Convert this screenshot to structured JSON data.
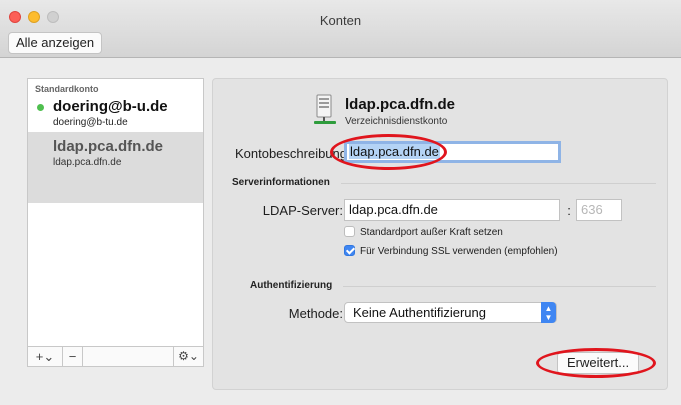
{
  "window": {
    "title": "Konten",
    "show_all_label": "Alle anzeigen"
  },
  "sidebar": {
    "header": "Standardkonto",
    "accounts": [
      {
        "name": "doering@b-u.de",
        "sub": "doering@b-tu.de",
        "status": "online",
        "selected": false
      },
      {
        "name": "ldap.pca.dfn.de",
        "sub": "ldap.pca.dfn.de",
        "selected": true
      }
    ],
    "toolbar": {
      "add_label": "+⌄",
      "remove_label": "−",
      "gear_label": "⚙⌄"
    }
  },
  "detail": {
    "icon": "directory-server-icon",
    "account_title": "ldap.pca.dfn.de",
    "account_type": "Verzeichnisdienstkonto",
    "description_label": "Kontobeschreibung",
    "description_value": "ldap.pca.dfn.de",
    "server_section": "Serverinformationen",
    "ldap_label": "LDAP-Server:",
    "ldap_value": "ldap.pca.dfn.de",
    "port_separator": ":",
    "port_placeholder": "636",
    "default_port_label": "Standardport außer Kraft setzen",
    "default_port_checked": false,
    "ssl_label": "Für Verbindung SSL verwenden (empfohlen)",
    "ssl_checked": true,
    "auth_section": "Authentifizierung",
    "method_label": "Methode:",
    "method_value": "Keine Authentifizierung",
    "advanced_label": "Erweitert..."
  },
  "colors": {
    "accent": "#3f86f2",
    "annotation": "#e0151d",
    "status_online": "#4fbf4f"
  }
}
